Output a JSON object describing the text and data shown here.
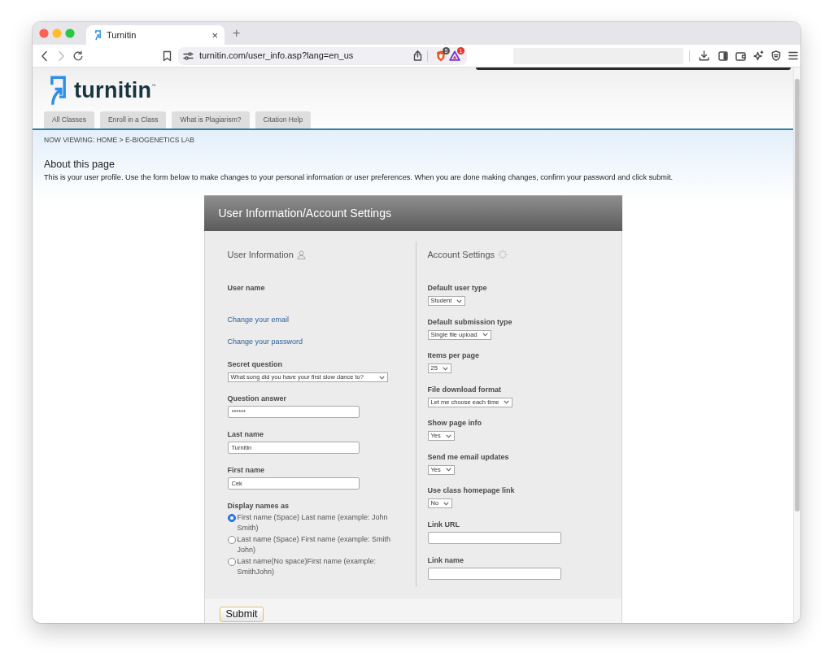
{
  "browser": {
    "tab_title": "Turnitin",
    "tab_close": "×",
    "new_tab": "+",
    "address": "turnitin.com/user_info.asp?lang=en_us",
    "shield_count": "5",
    "alert_count": "1"
  },
  "header": {
    "logo": "turnitin$^{™}$",
    "nav_tabs": [
      "All Classes",
      "Enroll in a Class",
      "What is Plagiarism?",
      "Citation Help"
    ]
  },
  "breadcrumb": {
    "label": "NOW VIEWING:",
    "links": [
      "HOME",
      "E-BIOGENETICS LAB"
    ],
    "separator": ">"
  },
  "about": {
    "title": "About this page",
    "text": "This is your user profile. Use the form below to make changes to your personal information or user preferences. When you are done making changes, confirm your password and click submit."
  },
  "form": {
    "title": "User Information/Account Settings",
    "user_information": {
      "heading": "User Information",
      "fields": [
        {
          "kind": "static",
          "label": "User name"
        },
        {
          "kind": "link",
          "label": "Change your email"
        },
        {
          "kind": "link",
          "label": "Change your password"
        },
        {
          "kind": "select",
          "label": "Secret question",
          "value": "What song did you have your first slow dance to?"
        },
        {
          "kind": "input",
          "label": "Question answer",
          "value": "******"
        },
        {
          "kind": "input",
          "label": "Last name",
          "value": "Turnitin"
        },
        {
          "kind": "input",
          "label": "First name",
          "value": "Cek"
        },
        {
          "kind": "radio",
          "label": "Display names as",
          "options": [
            {
              "label": "First name (Space) Last name (example: John Smith)",
              "selected": true
            },
            {
              "label": "Last name (Space) First name (example: Smith John)",
              "selected": false
            },
            {
              "label": "Last name(No space)First name (example: SmithJohn)",
              "selected": false
            }
          ]
        }
      ]
    },
    "account_settings": {
      "heading": "Account Settings",
      "fields": [
        {
          "kind": "select",
          "label": "Default user type",
          "value": "Student"
        },
        {
          "kind": "select",
          "label": "Default submission type",
          "value": "Single file upload"
        },
        {
          "kind": "select",
          "label": "Items per page",
          "value": "25"
        },
        {
          "kind": "select",
          "label": "File download format",
          "value": "Let me choose each time"
        },
        {
          "kind": "select",
          "label": "Show page info",
          "value": "Yes"
        },
        {
          "kind": "select",
          "label": "Send me email updates",
          "value": "Yes"
        },
        {
          "kind": "select",
          "label": "Use class homepage link",
          "value": "No"
        },
        {
          "kind": "input",
          "label": "Link URL"
        },
        {
          "kind": "input",
          "label": "Link name"
        }
      ]
    },
    "submit": "Submit"
  }
}
